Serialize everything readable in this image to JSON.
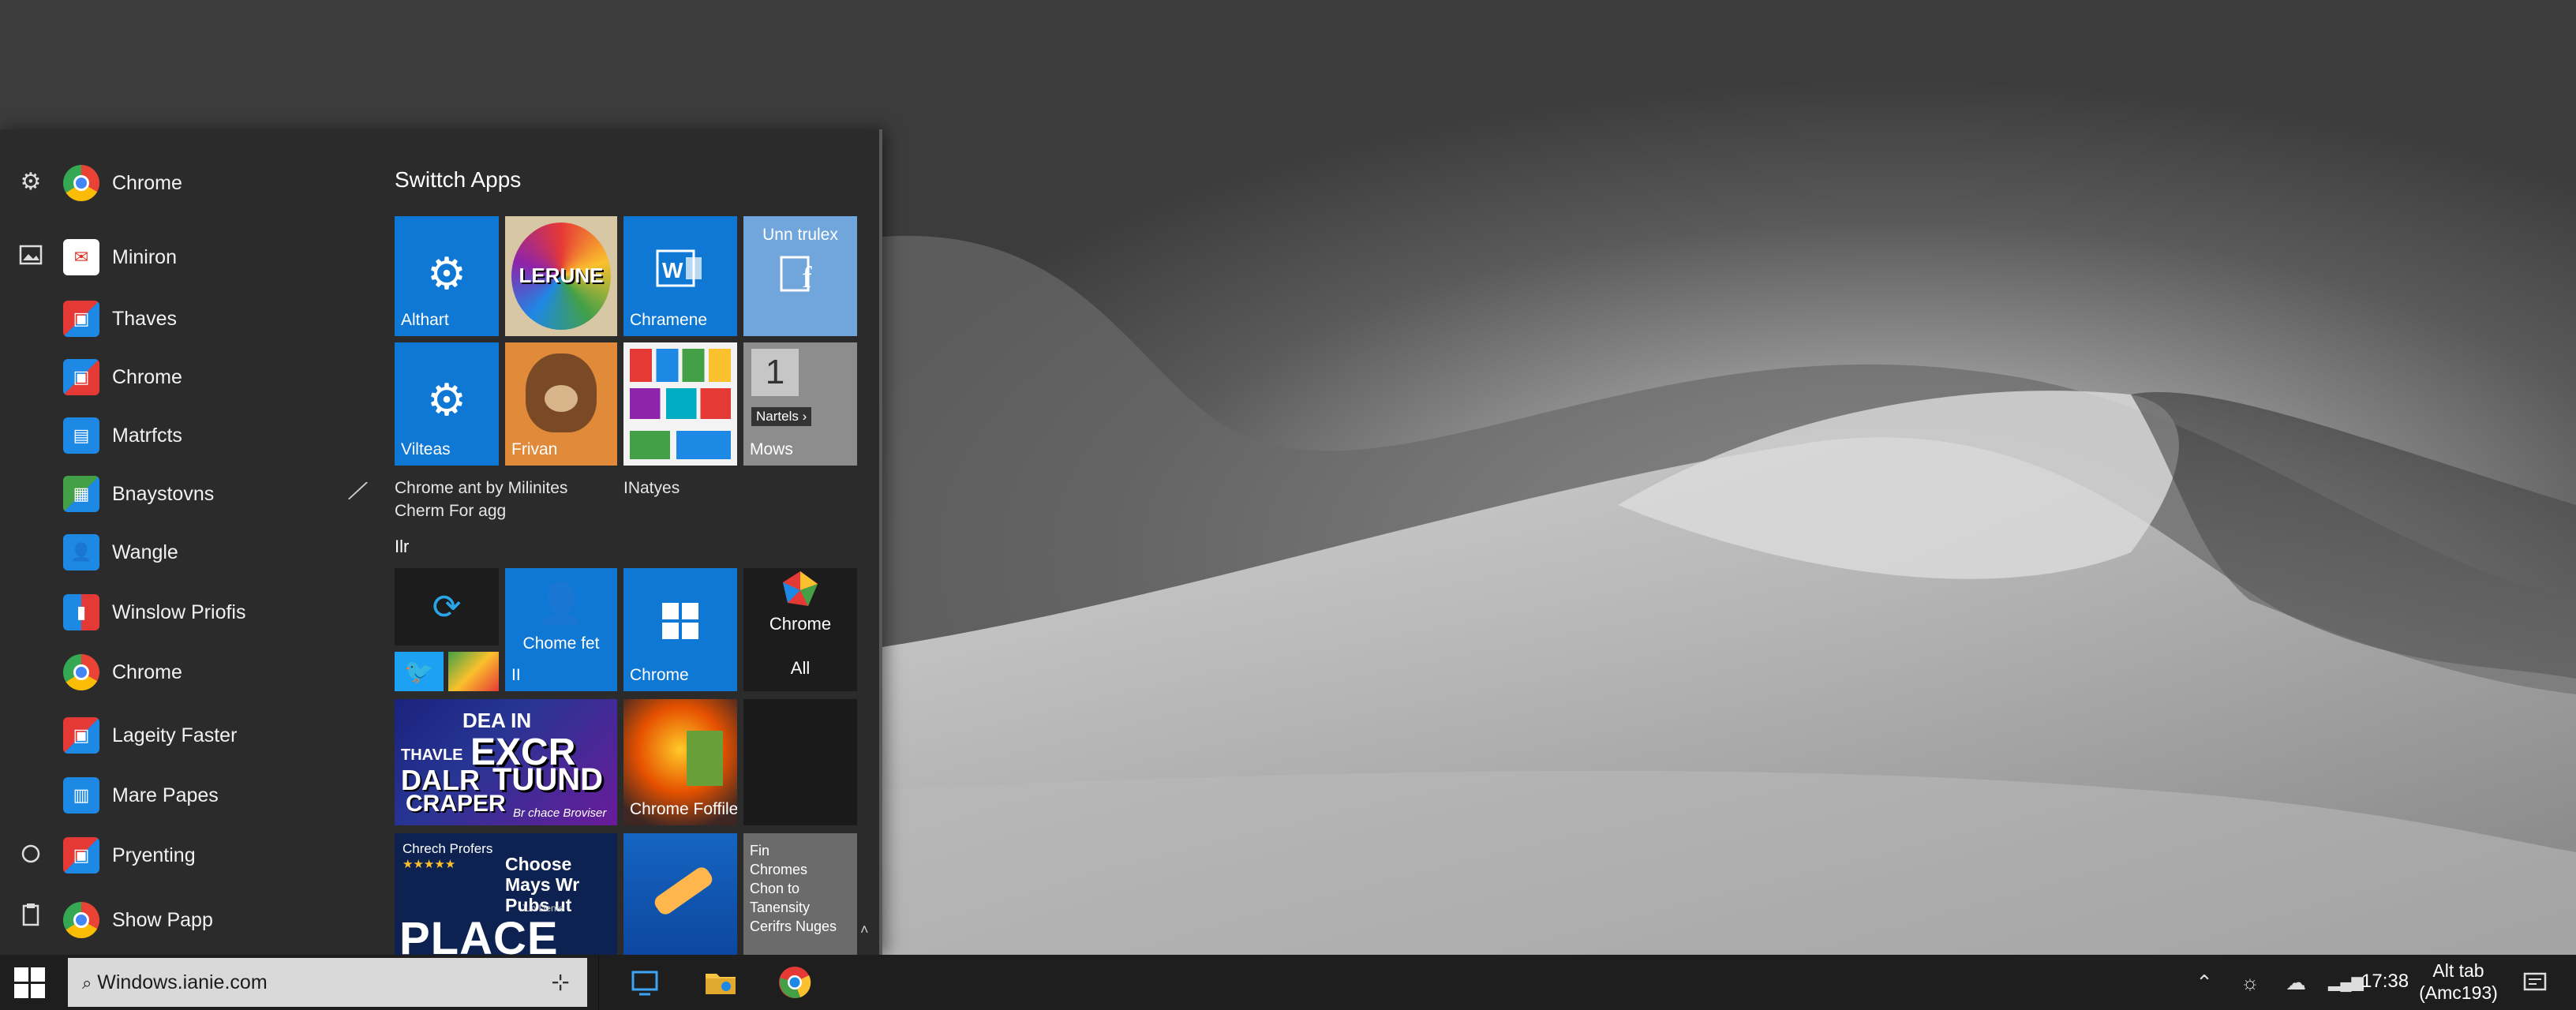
{
  "start_menu": {
    "rail": {
      "settings_icon": "gear-icon",
      "pictures_icon": "image-icon",
      "power_icon": "power-icon",
      "docs_icon": "clipboard-icon"
    },
    "apps": [
      {
        "label": "Chrome",
        "icon": "chrome-icon"
      },
      {
        "label": "Miniron",
        "icon": "mail-icon"
      },
      {
        "label": "Thaves",
        "icon": "app-icon"
      },
      {
        "label": "Chrome",
        "icon": "app-icon"
      },
      {
        "label": "Matrfcts",
        "icon": "app-icon"
      },
      {
        "label": "Bnaystovns",
        "icon": "app-icon"
      },
      {
        "label": "Wangle",
        "icon": "person-icon"
      },
      {
        "label": "Winslow Priofis",
        "icon": "app-icon"
      },
      {
        "label": "Chrome",
        "icon": "chrome-icon"
      },
      {
        "label": "Lageity Faster",
        "icon": "app-icon"
      },
      {
        "label": "Mare Papes",
        "icon": "app-icon"
      },
      {
        "label": "Pryenting",
        "icon": "app-icon"
      },
      {
        "label": "Show Papp",
        "icon": "chrome-icon"
      }
    ],
    "tiles": {
      "group1_title": "Swittch Apps",
      "t_althart": "Althart",
      "t_lerune": "LERUNE",
      "t_chramene": "Chramene",
      "t_unn_title": "Unn trulex",
      "t_vilteas": "Vilteas",
      "t_frivan": "Frivan",
      "t_nartels": "Nartels ›",
      "t_mows": "Mows",
      "caption1_line1": "Chrome ant by Milinites",
      "caption1_line2": "Cherm For agg",
      "caption2": "INatyes",
      "group2_title": "Ilr",
      "t_chome_fet": "Chome fet",
      "t_chome_fet_sub": "II",
      "t_chrome_win": "Chrome",
      "t_chrome_logo_label": "Chrome",
      "t_all": "All",
      "t_poster_lines": [
        "DEA IN",
        "EXCR",
        "TUUND",
        "THAVLE",
        "DALR",
        "CRAPER",
        "Br chace Broviser"
      ],
      "t_chrome_foffiles": "Chrome Foffiles",
      "t_place_top": "Chrech Profers",
      "t_place_mid": "Choose Mays Wr Pubs ut",
      "t_place_big": "PLACE",
      "t_place_sub": "Jun Dente",
      "t_fin_lines": [
        "Fin",
        "Chromes",
        "Chon to",
        "Tanensity",
        "Cerifrs Nuges"
      ]
    }
  },
  "taskbar": {
    "search_text": "Windows.ianie.com",
    "clock": "17:38",
    "alttab_line1": "Alt tab",
    "alttab_line2": "(Amc193)"
  }
}
